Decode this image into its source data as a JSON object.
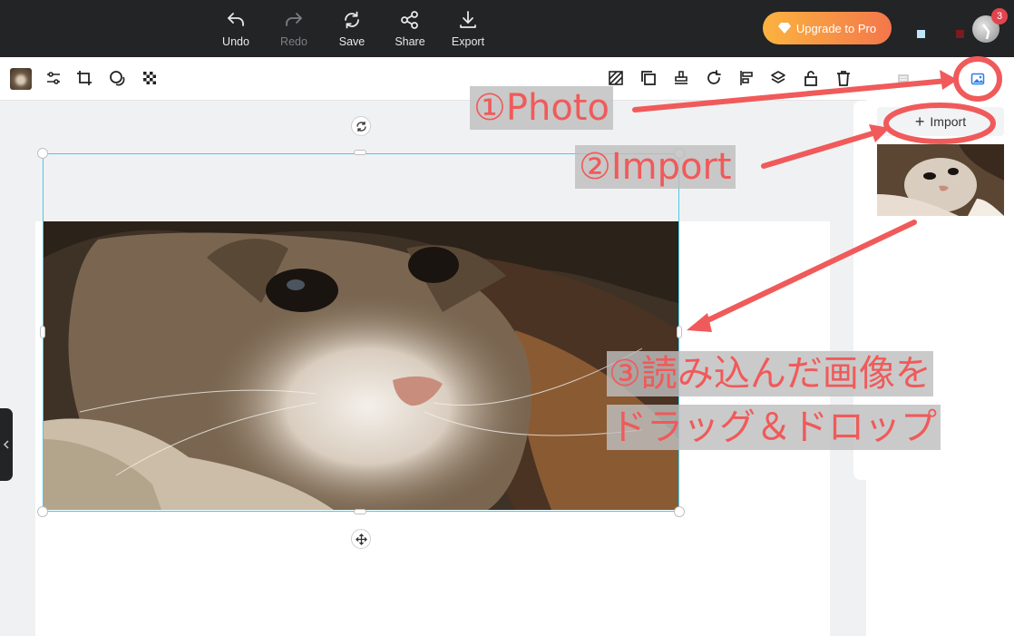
{
  "topbar": {
    "actions": [
      {
        "label": "Undo",
        "icon": "undo-icon",
        "disabled": false
      },
      {
        "label": "Redo",
        "icon": "redo-icon",
        "disabled": true
      },
      {
        "label": "Save",
        "icon": "save-icon",
        "disabled": false
      },
      {
        "label": "Share",
        "icon": "share-icon",
        "disabled": false
      },
      {
        "label": "Export",
        "icon": "export-icon",
        "disabled": false
      }
    ],
    "upgrade_label": "Upgrade to Pro",
    "notification_count": "3"
  },
  "toolbar": {
    "left_tools": [
      "image-thumbnail",
      "adjust-icon",
      "crop-icon",
      "mask-icon",
      "transparency-icon"
    ],
    "right_tools": [
      "pattern-icon",
      "duplicate-icon",
      "stamp-icon",
      "rotate-icon",
      "align-icon",
      "layers-icon",
      "lock-icon",
      "delete-icon"
    ]
  },
  "right_panel": {
    "tabs": [
      "text-icon",
      "photo-icon"
    ],
    "active_tab": "photo-icon",
    "import_label": "Import"
  },
  "annotations": {
    "step1": "①Photo",
    "step2": "②Import",
    "step3_line1": "③読み込んだ画像を",
    "step3_line2": "ドラッグ＆ドロップ"
  },
  "colors": {
    "topbar_bg": "#222426",
    "selection": "#4cc8e8",
    "annotation_red": "#f05a5a",
    "active_tab": "#2b7de9",
    "upgrade_gradient": [
      "#fbb33f",
      "#f4774b"
    ]
  }
}
